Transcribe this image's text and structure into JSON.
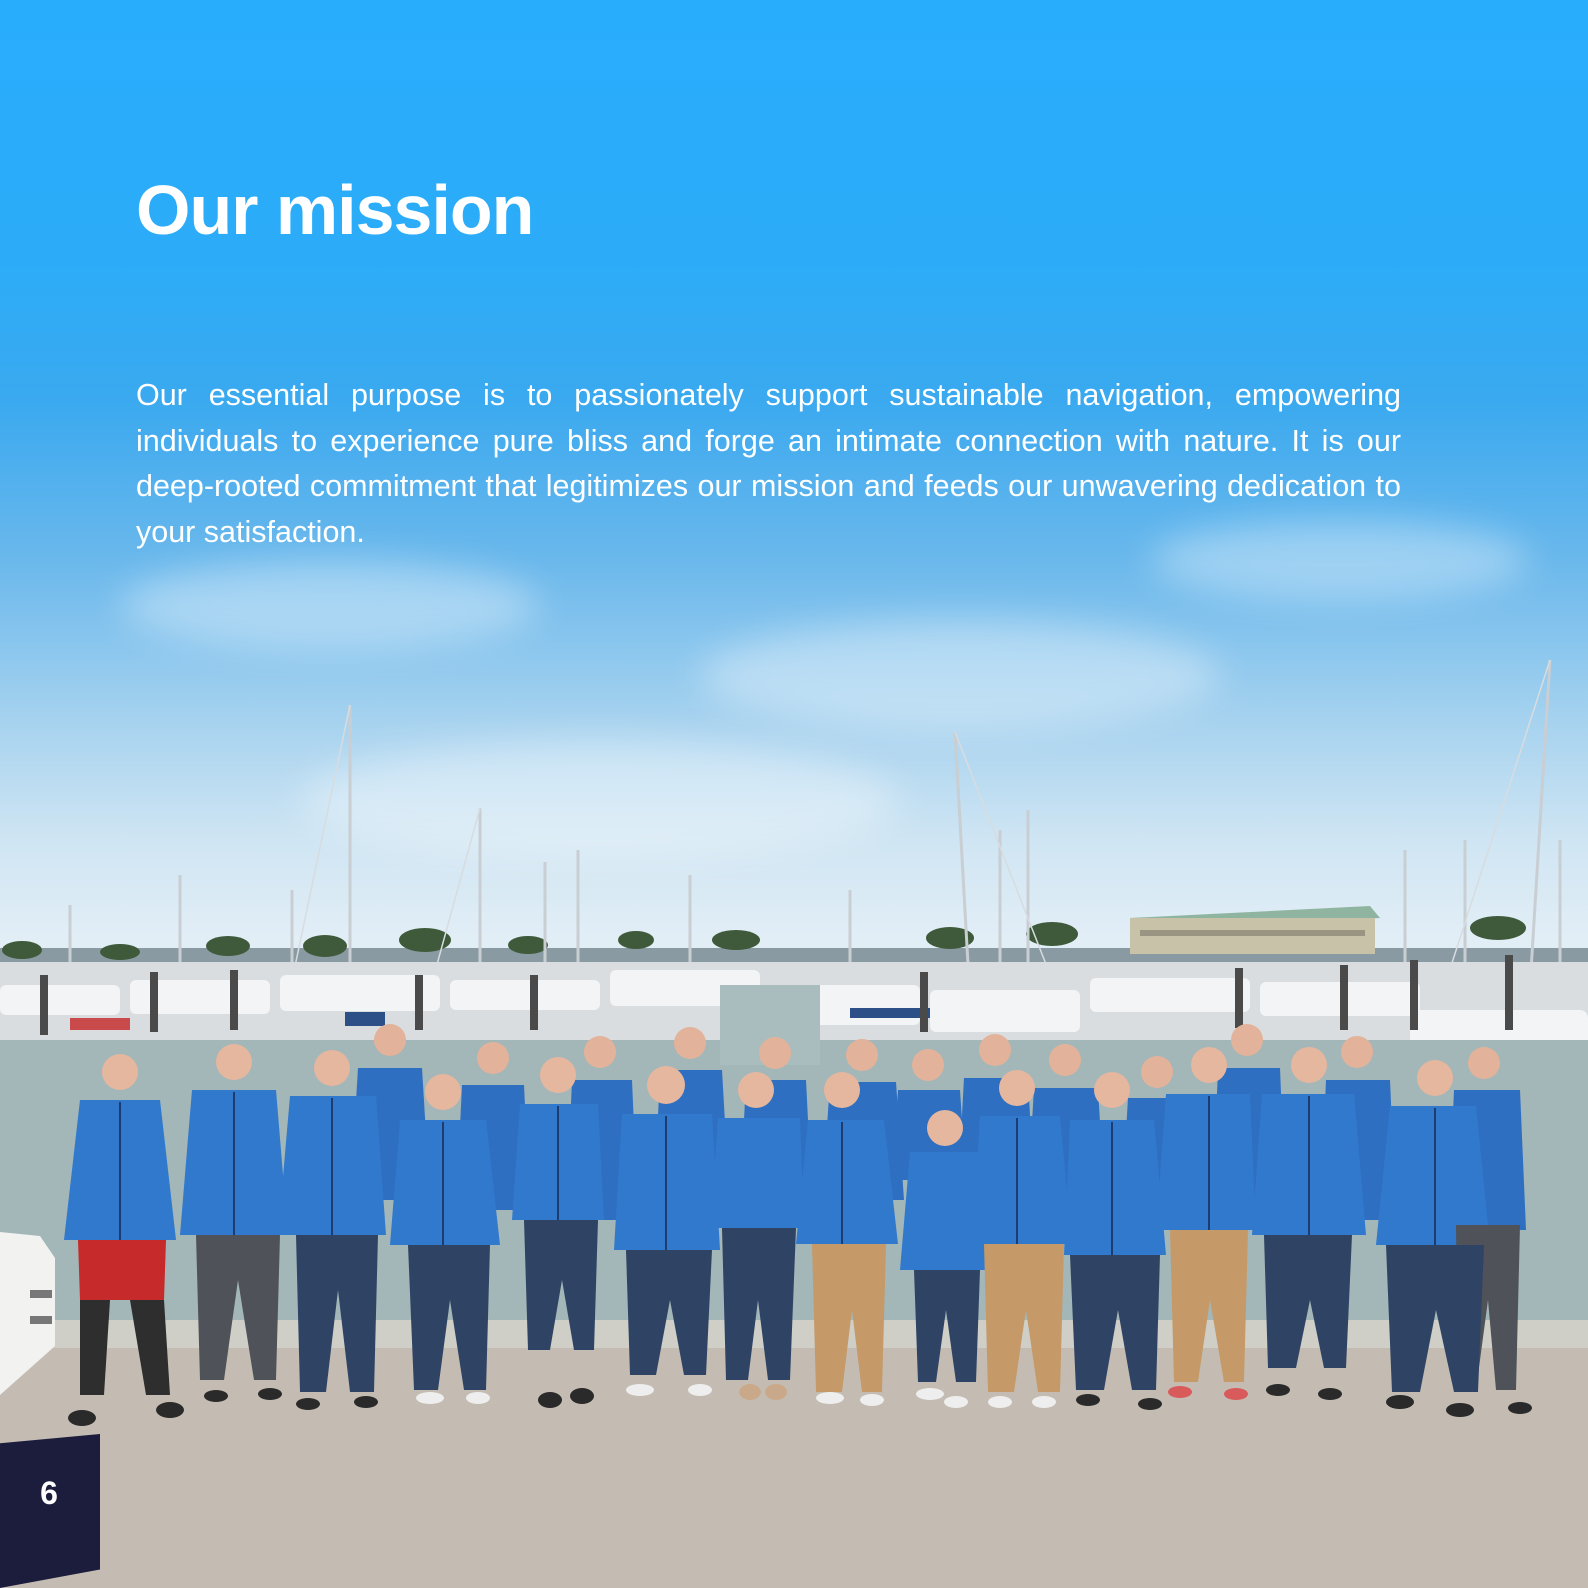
{
  "page": {
    "title": "Our mission",
    "body": "Our essential purpose is to passionately support sustainable navigation, empowering individuals to experience pure bliss and forge an intimate connection with nature. It is our deep-rooted commitment that legitimizes our mission and feeds our unwavering dedication to your satisfaction.",
    "page_number": "6"
  },
  "photo": {
    "subject": "team-photo-marina",
    "jacket_color": "#2f72c4",
    "sky_color_top": "#28adfd"
  },
  "colors": {
    "accent_dark": "#1c1d3d",
    "text": "#ffffff"
  }
}
